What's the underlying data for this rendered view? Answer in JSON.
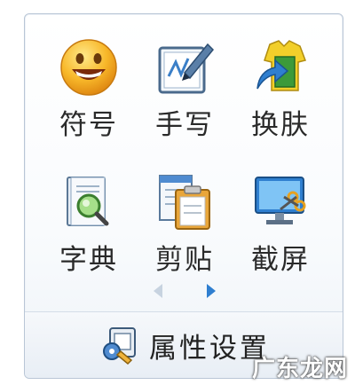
{
  "tools": [
    {
      "label": "符号",
      "icon": "smiley-icon"
    },
    {
      "label": "手写",
      "icon": "handwriting-pen-icon"
    },
    {
      "label": "换肤",
      "icon": "skin-shirt-icon"
    },
    {
      "label": "字典",
      "icon": "dictionary-magnifier-icon"
    },
    {
      "label": "剪贴",
      "icon": "clipboard-icon"
    },
    {
      "label": "截屏",
      "icon": "screenshot-scissors-icon"
    }
  ],
  "pager": {
    "prev_icon": "left-arrow-icon",
    "next_icon": "right-arrow-icon"
  },
  "settings": {
    "label": "属性设置",
    "icon": "settings-wrench-icon"
  },
  "watermark": "广东龙网",
  "colors": {
    "border": "#b9c6d6",
    "arrow_inactive": "#c7d3e0",
    "arrow_active": "#2f7fd0"
  }
}
